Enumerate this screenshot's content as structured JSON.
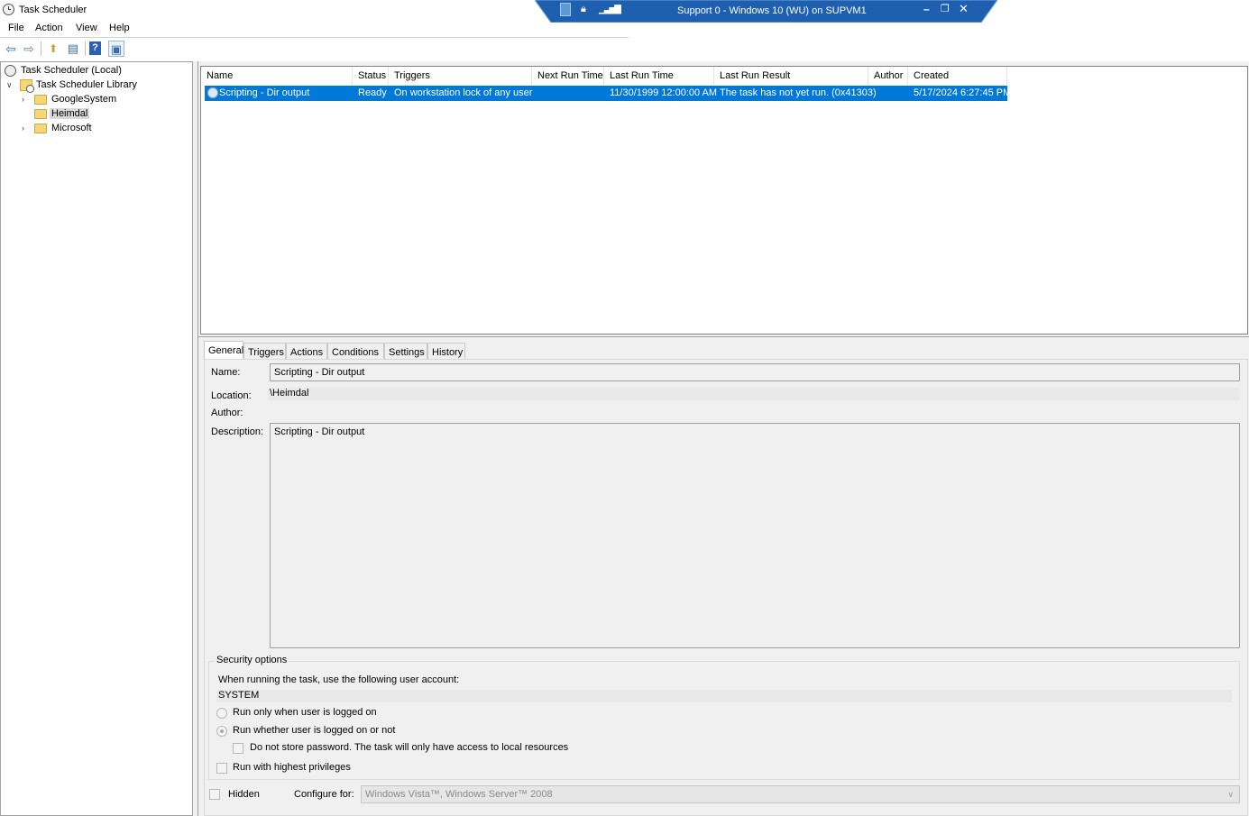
{
  "window": {
    "title": "Task Scheduler"
  },
  "rdp": {
    "title": "Support 0 - Windows 10 (WU) on SUPVM1",
    "minimize": "–",
    "restore": "❐",
    "close": "✕"
  },
  "menu": [
    "File",
    "Action",
    "View",
    "Help"
  ],
  "toolbar": {
    "back": "⇦",
    "forward": "⇨",
    "up": "⬆",
    "show_hide": "▤",
    "help": "?",
    "properties": "▣"
  },
  "tree": {
    "root": "Task Scheduler (Local)",
    "library": "Task Scheduler Library",
    "children": [
      "GoogleSystem",
      "Heimdal",
      "Microsoft"
    ]
  },
  "list": {
    "columns": [
      "Name",
      "Status",
      "Triggers",
      "Next Run Time",
      "Last Run Time",
      "Last Run Result",
      "Author",
      "Created"
    ],
    "rows": [
      {
        "name": "Scripting - Dir output",
        "status": "Ready",
        "triggers": "On workstation lock of any user",
        "next_run": "",
        "last_run": "11/30/1999 12:00:00 AM",
        "last_result": "The task has not yet run. (0x41303)",
        "author": "",
        "created": "5/17/2024 6:27:45 PM"
      }
    ]
  },
  "tabs": [
    "General",
    "Triggers",
    "Actions",
    "Conditions",
    "Settings",
    "History"
  ],
  "general": {
    "name_label": "Name:",
    "name_value": "Scripting - Dir output",
    "location_label": "Location:",
    "location_value": "\\Heimdal",
    "author_label": "Author:",
    "author_value": "",
    "description_label": "Description:",
    "description_value": "Scripting - Dir output"
  },
  "security": {
    "title": "Security options",
    "account_prompt": "When running the task, use the following user account:",
    "account": "SYSTEM",
    "opt_logged_on": "Run only when user is logged on",
    "opt_whether": "Run whether user is logged on or not",
    "opt_no_store": "Do not store password.  The task will only have access to local resources",
    "opt_highest": "Run with highest privileges"
  },
  "footer": {
    "hidden_label": "Hidden",
    "configure_label": "Configure for:",
    "configure_value": "Windows Vista™, Windows Server™ 2008"
  },
  "colors": {
    "selection": "#0078d7",
    "rdp_bar": "#1f5fb0"
  }
}
